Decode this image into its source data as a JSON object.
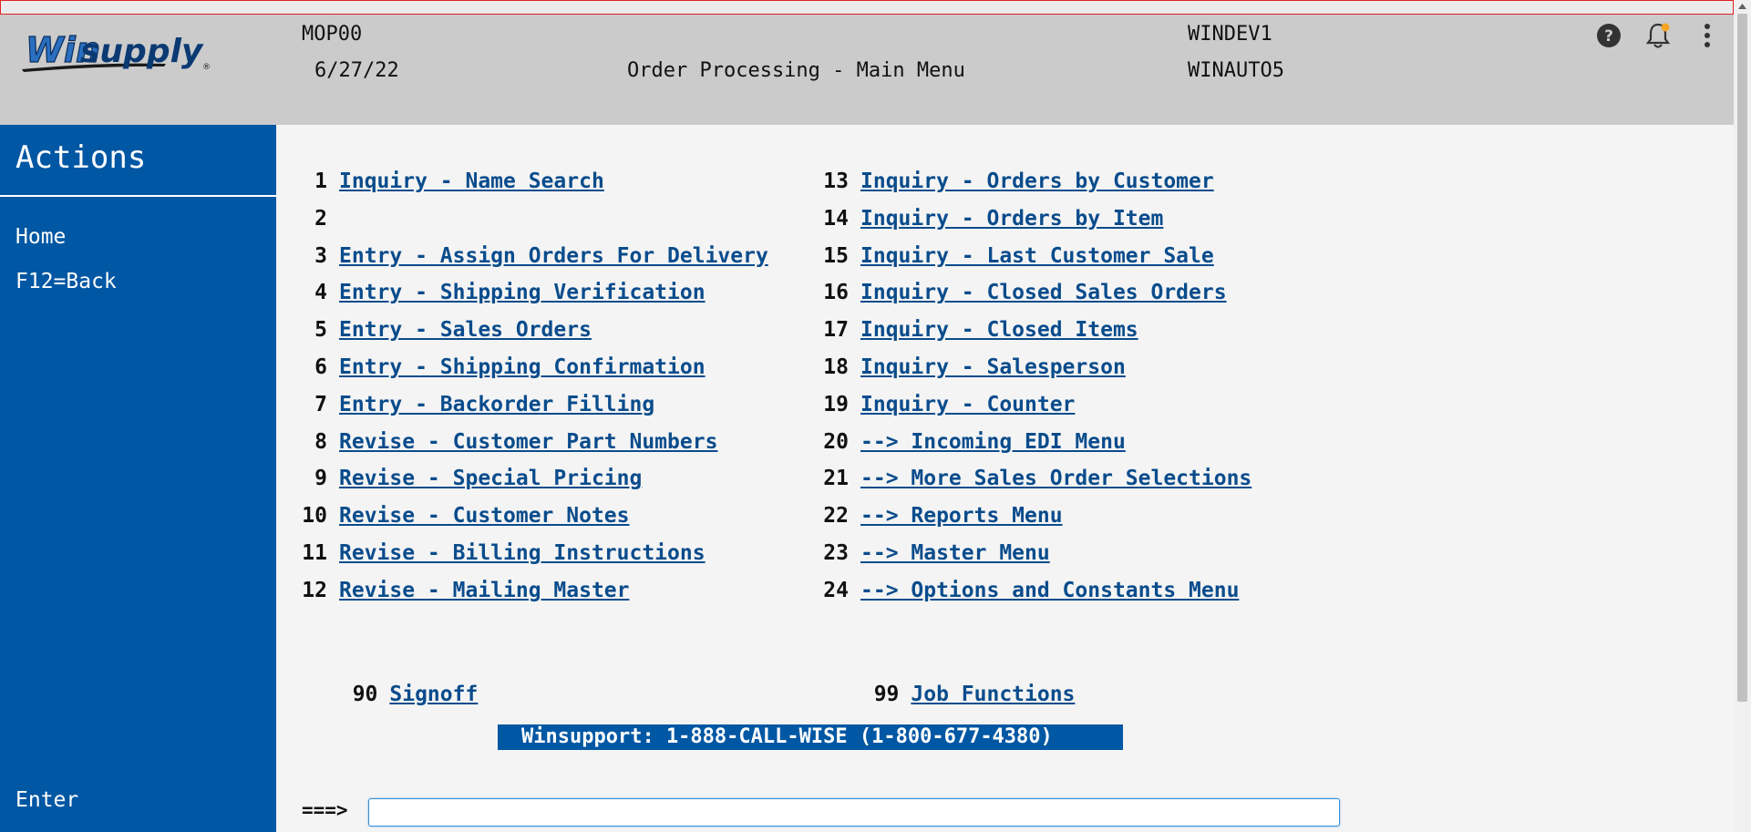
{
  "header": {
    "program": "MOP00",
    "date": "6/27/22",
    "title": "Order Processing - Main Menu",
    "system": "WINDEV1",
    "user": "WINAUTO5",
    "logo_text_1": "Win",
    "logo_text_2": "supply",
    "icons": [
      "help-icon",
      "bell-icon",
      "more-vertical-icon"
    ],
    "notification_dot_color": "#f5a623"
  },
  "sidebar": {
    "title": "Actions",
    "items": [
      {
        "label": "Home"
      },
      {
        "label": "F12=Back"
      }
    ],
    "enter_label": "Enter"
  },
  "menu": {
    "left": [
      {
        "num": "1",
        "label": "Inquiry - Name Search"
      },
      {
        "num": "2",
        "label": ""
      },
      {
        "num": "3",
        "label": "Entry - Assign Orders For Delivery"
      },
      {
        "num": "4",
        "label": "Entry - Shipping Verification"
      },
      {
        "num": "5",
        "label": "Entry - Sales Orders"
      },
      {
        "num": "6",
        "label": "Entry - Shipping Confirmation"
      },
      {
        "num": "7",
        "label": "Entry - Backorder Filling"
      },
      {
        "num": "8",
        "label": "Revise - Customer Part Numbers"
      },
      {
        "num": "9",
        "label": "Revise - Special Pricing"
      },
      {
        "num": "10",
        "label": "Revise - Customer Notes"
      },
      {
        "num": "11",
        "label": "Revise - Billing Instructions"
      },
      {
        "num": "12",
        "label": "Revise - Mailing Master"
      }
    ],
    "right": [
      {
        "num": "13",
        "label": "Inquiry - Orders by Customer"
      },
      {
        "num": "14",
        "label": "Inquiry - Orders by Item"
      },
      {
        "num": "15",
        "label": "Inquiry - Last Customer Sale"
      },
      {
        "num": "16",
        "label": "Inquiry - Closed Sales Orders"
      },
      {
        "num": "17",
        "label": "Inquiry - Closed Items"
      },
      {
        "num": "18",
        "label": "Inquiry - Salesperson"
      },
      {
        "num": "19",
        "label": "Inquiry - Counter"
      },
      {
        "num": "20",
        "label": "--> Incoming EDI Menu"
      },
      {
        "num": "21",
        "label": "--> More Sales Order Selections"
      },
      {
        "num": "22",
        "label": "--> Reports Menu"
      },
      {
        "num": "23",
        "label": "--> Master Menu"
      },
      {
        "num": "24",
        "label": "--> Options and Constants Menu"
      }
    ],
    "signoff": {
      "num": "90",
      "label": "Signoff"
    },
    "job": {
      "num": "99",
      "label": "Job Functions"
    }
  },
  "support": "Winsupport: 1-888-CALL-WISE (1-800-677-4380)",
  "command": {
    "prompt": "===>",
    "value": ""
  },
  "colors": {
    "brand_blue": "#0057a3",
    "link_blue": "#0a4c8c",
    "header_gray": "#cbcbcb"
  }
}
